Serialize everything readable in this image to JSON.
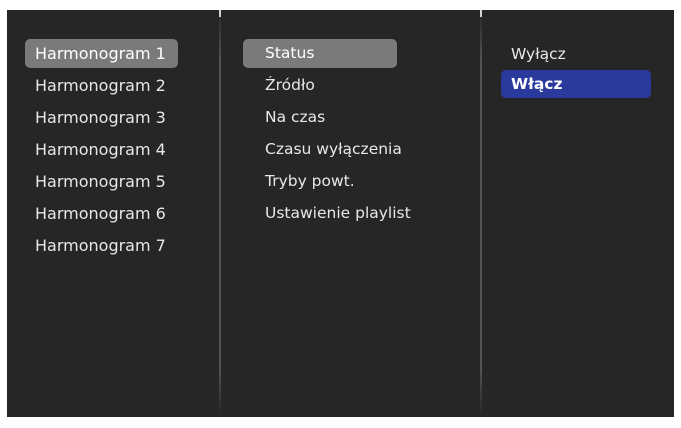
{
  "menu": {
    "schedules": [
      {
        "label": "Harmonogram 1",
        "state": "highlight"
      },
      {
        "label": "Harmonogram 2",
        "state": "normal"
      },
      {
        "label": "Harmonogram 3",
        "state": "normal"
      },
      {
        "label": "Harmonogram 4",
        "state": "normal"
      },
      {
        "label": "Harmonogram 5",
        "state": "normal"
      },
      {
        "label": "Harmonogram 6",
        "state": "normal"
      },
      {
        "label": "Harmonogram 7",
        "state": "normal"
      }
    ],
    "settings": [
      {
        "label": "Status",
        "state": "highlight"
      },
      {
        "label": "Źródło",
        "state": "normal"
      },
      {
        "label": "Na czas",
        "state": "normal"
      },
      {
        "label": "Czasu wyłączenia",
        "state": "normal"
      },
      {
        "label": "Tryby powt.",
        "state": "normal"
      },
      {
        "label": "Ustawienie playlist",
        "state": "normal"
      }
    ],
    "options": [
      {
        "label": "Wyłącz",
        "state": "normal"
      },
      {
        "label": "Włącz",
        "state": "selected"
      }
    ]
  },
  "colors": {
    "background": "#262626",
    "highlight": "#7a7a7a",
    "selected": "#2a3a9c",
    "text": "#e8e8e8"
  }
}
